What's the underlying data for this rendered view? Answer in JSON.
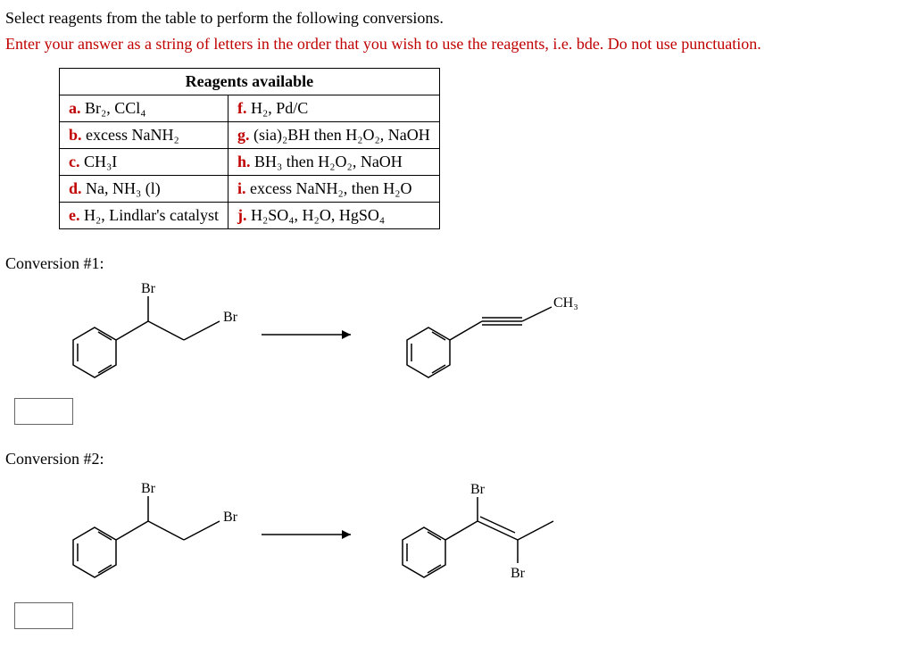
{
  "instructions": {
    "line1": "Select reagents from the table to perform the following conversions.",
    "line2": "Enter your answer as a string of letters in the order that you wish to use the reagents, i.e. bde. Do not use punctuation."
  },
  "table": {
    "header": "Reagents available",
    "rows": [
      {
        "left_letter": "a.",
        "left_text": "Br₂, CCl₄",
        "right_letter": "f.",
        "right_text": "H₂, Pd/C"
      },
      {
        "left_letter": "b.",
        "left_text": "excess NaNH₂",
        "right_letter": "g.",
        "right_text": "(sia)₂BH then H₂O₂, NaOH"
      },
      {
        "left_letter": "c.",
        "left_text": "CH₃I",
        "right_letter": "h.",
        "right_text": "BH₃ then H₂O₂, NaOH"
      },
      {
        "left_letter": "d.",
        "left_text": "Na, NH₃ (l)",
        "right_letter": "i.",
        "right_text": "excess NaNH₂, then H₂O"
      },
      {
        "left_letter": "e.",
        "left_text": "H₂, Lindlar's catalyst",
        "right_letter": "j.",
        "right_text": "H₂SO₄, H₂O, HgSO₄"
      }
    ]
  },
  "conversions": {
    "c1_label": "Conversion #1:",
    "c2_label": "Conversion #2:",
    "labels": {
      "br": "Br",
      "ch3": "CH₃"
    }
  },
  "answers": {
    "c1": "",
    "c2": ""
  }
}
